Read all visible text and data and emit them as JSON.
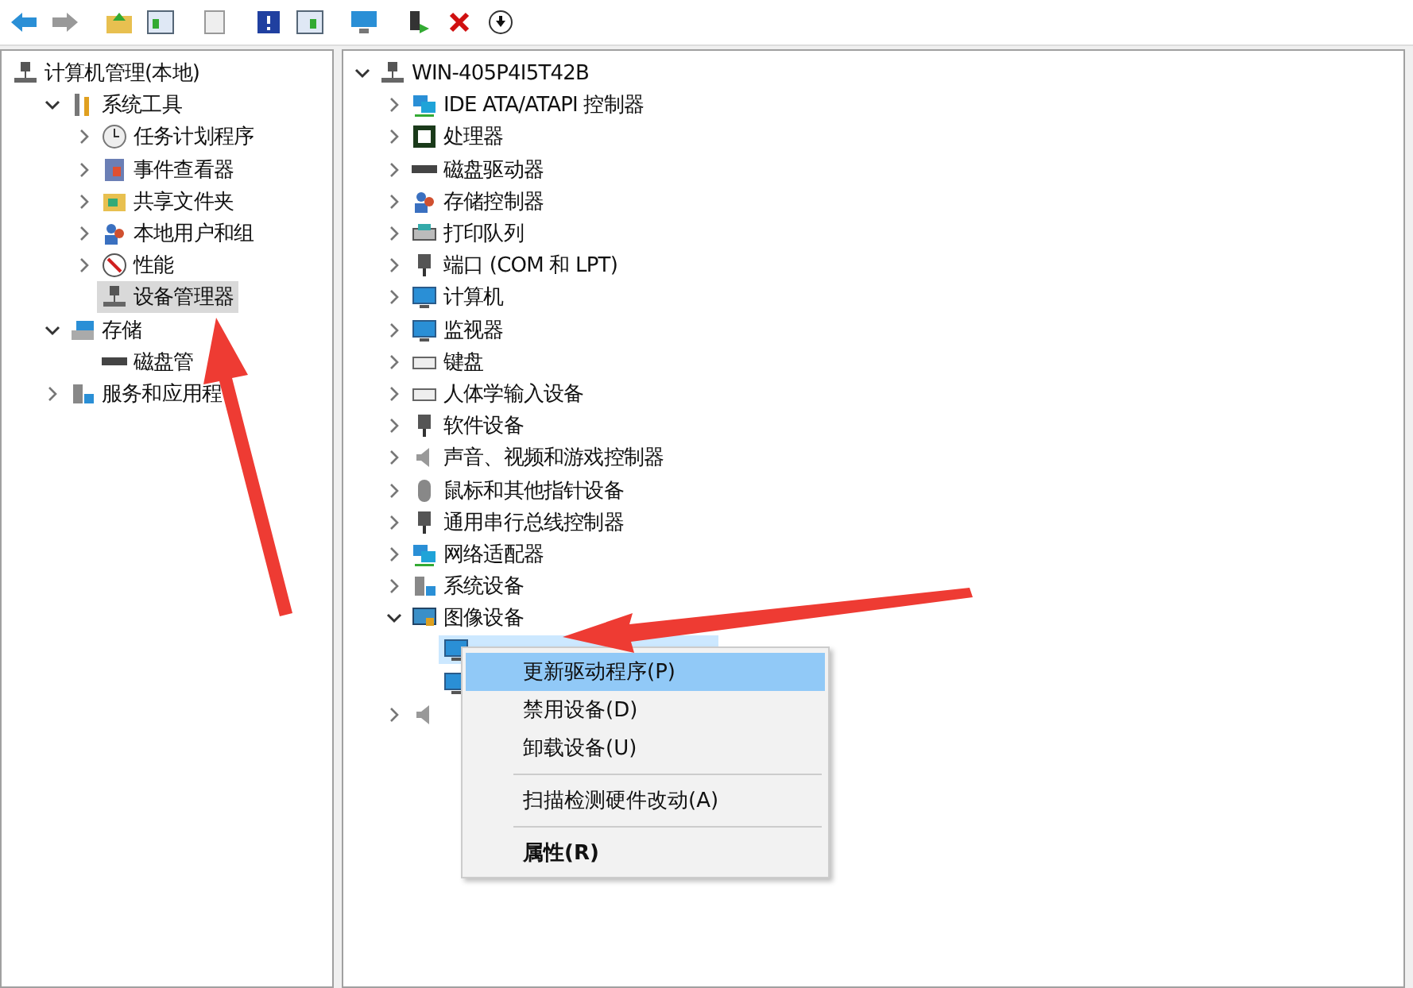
{
  "left_tree": [
    {
      "label": "计算机管理(本地)",
      "children": [
        {
          "label": "系统工具",
          "expanded": true,
          "children": [
            {
              "label": "任务计划程序",
              "expanded": false,
              "selected": false
            },
            {
              "label": "事件查看器",
              "expanded": false,
              "selected": false
            },
            {
              "label": "共享文件夹",
              "expanded": false,
              "selected": false
            },
            {
              "label": "本地用户和组",
              "expanded": false,
              "selected": false
            },
            {
              "label": "性能",
              "expanded": false,
              "selected": false
            },
            {
              "label": "设备管理器",
              "selected": true
            }
          ]
        },
        {
          "label": "存储",
          "expanded": true,
          "children": [
            {
              "label": "磁盘管",
              "selected": false
            }
          ]
        },
        {
          "label": "服务和应用程",
          "expanded": false
        }
      ]
    }
  ],
  "device_tree": {
    "label": "WIN-405P4I5T42B",
    "expanded": true,
    "children": [
      {
        "label": "IDE ATA/ATAPI 控制器",
        "expanded": false
      },
      {
        "label": "处理器",
        "expanded": false
      },
      {
        "label": "磁盘驱动器",
        "expanded": false
      },
      {
        "label": "存储控制器",
        "expanded": false
      },
      {
        "label": "打印队列",
        "expanded": false
      },
      {
        "label": "端口 (COM 和 LPT)",
        "expanded": false
      },
      {
        "label": "计算机",
        "expanded": false
      },
      {
        "label": "监视器",
        "expanded": false
      },
      {
        "label": "键盘",
        "expanded": false
      },
      {
        "label": "人体学输入设备",
        "expanded": false
      },
      {
        "label": "软件设备",
        "expanded": false
      },
      {
        "label": "声音、视频和游戏控制器",
        "expanded": false
      },
      {
        "label": "鼠标和其他指针设备",
        "expanded": false
      },
      {
        "label": "通用串行总线控制器",
        "expanded": false
      },
      {
        "label": "网络适配器",
        "expanded": false
      },
      {
        "label": "系统设备",
        "expanded": false
      },
      {
        "label": "图像设备",
        "expanded": true,
        "children": [
          {
            "selected": true
          },
          {
            "selected": false
          }
        ]
      },
      {
        "expanded": false
      }
    ]
  },
  "context_menu": [
    {
      "kind": "item",
      "label": "更新驱动程序(P)",
      "selected": true
    },
    {
      "kind": "item",
      "label": "禁用设备(D)",
      "selected": false
    },
    {
      "kind": "item",
      "label": "卸载设备(U)",
      "selected": false
    },
    {
      "kind": "separator"
    },
    {
      "kind": "item",
      "label": "扫描检测硬件改动(A)",
      "selected": false
    },
    {
      "kind": "separator"
    },
    {
      "kind": "item",
      "label": "属性(R)",
      "selected": false,
      "default": true
    }
  ]
}
